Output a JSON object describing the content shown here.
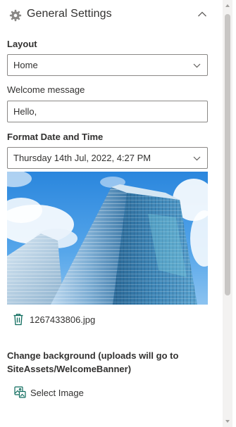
{
  "section": {
    "title": "General Settings",
    "icon": "gear-icon",
    "expanded": true
  },
  "layout": {
    "label": "Layout",
    "selected": "Home"
  },
  "welcome": {
    "label": "Welcome message",
    "value": "Hello,"
  },
  "date_format": {
    "label": "Format Date and Time",
    "selected": "Thursday 14th Jul, 2022, 4:27 PM"
  },
  "background": {
    "file_name": "1267433806.jpg",
    "change_label": "Change background (uploads will go to SiteAssets/WelcomeBanner)",
    "select_label": "Select Image"
  },
  "colors": {
    "accent": "#0f6c5e",
    "border": "#8a8886",
    "text": "#323130"
  }
}
